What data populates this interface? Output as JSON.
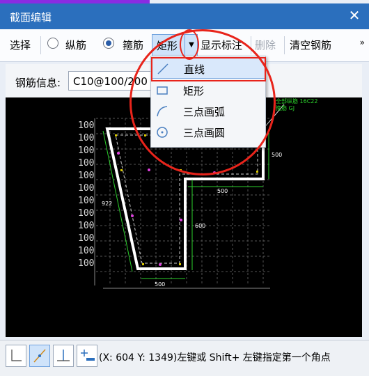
{
  "window": {
    "title": "截面编辑",
    "close": "✕"
  },
  "toolbar": {
    "select": "选择",
    "longitudinal": "纵筋",
    "stirrup": "箍筋",
    "shape": "矩形",
    "dropdown": "▼",
    "show_label": "显示标注",
    "delete": "删除",
    "clear": "清空钢筋",
    "more": "»"
  },
  "info": {
    "label": "钢筋信息:",
    "value": "C10@100/200"
  },
  "canvas": {
    "y_ticks": [
      "100",
      "100",
      "100",
      "100",
      "100",
      "100",
      "100",
      "100",
      "100",
      "100",
      "100",
      "100"
    ],
    "dims": {
      "d922": "922",
      "d600": "600",
      "d500a": "500",
      "d500b": "500",
      "d500c": "500"
    },
    "annot1": "全部纵筋  16C22",
    "annot2": "箍筋       GJ"
  },
  "menu": {
    "items": [
      {
        "label": "直线"
      },
      {
        "label": "矩形"
      },
      {
        "label": "三点画弧"
      },
      {
        "label": "三点画圆"
      }
    ]
  },
  "status": {
    "text": "(X: 604 Y: 1349)左键或 Shift+ 左键指定第一个角点"
  },
  "colors": {
    "titlebar": "#2b6fbd",
    "accent_red": "#e8241b",
    "green": "#2bd02b"
  }
}
